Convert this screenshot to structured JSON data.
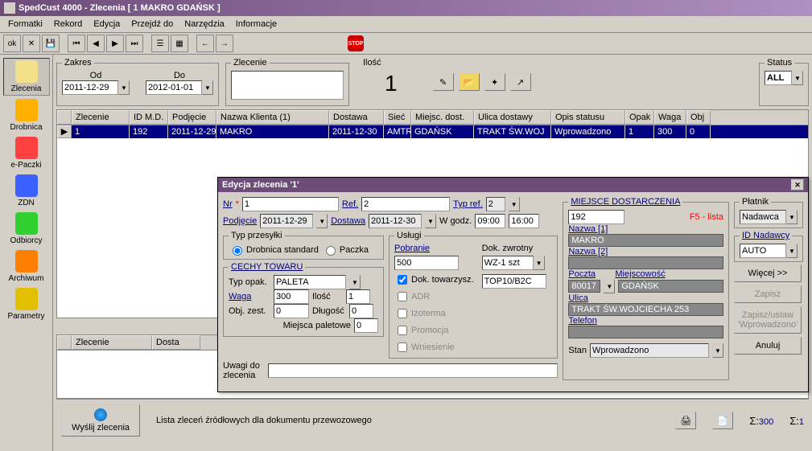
{
  "title": "SpedCust 4000 - Zlecenia [ 1 MAKRO GDAŃSK ]",
  "menu": [
    "Formatki",
    "Rekord",
    "Edycja",
    "Przejdź do",
    "Narzędzia",
    "Informacje"
  ],
  "toolbar": {
    "stop": "STOP"
  },
  "sidebar": [
    {
      "label": "Zlecenia",
      "icon": "#F5E08A"
    },
    {
      "label": "Drobnica",
      "icon": "#FFB000"
    },
    {
      "label": "e-Paczki",
      "icon": "#FF4040"
    },
    {
      "label": "ZDN",
      "icon": "#3A60FF"
    },
    {
      "label": "Odbiorcy",
      "icon": "#30D030"
    },
    {
      "label": "Archiwum",
      "icon": "#FF8000"
    },
    {
      "label": "Parametry",
      "icon": "#E0C000"
    }
  ],
  "panels": {
    "zakres": {
      "legend": "Zakres",
      "od_label": "Od",
      "do_label": "Do",
      "od": "2011-12-29",
      "do": "2012-01-01"
    },
    "zlecenie": {
      "legend": "Zlecenie",
      "value": ""
    },
    "ilosc": {
      "legend": "Ilość",
      "value": "1"
    },
    "status": {
      "legend": "Status",
      "value": "ALL"
    }
  },
  "grid": {
    "headers": [
      "Zlecenie",
      "ID M.D.",
      "Podjęcie",
      "Nazwa Klienta (1)",
      "Dostawa",
      "Sieć",
      "Miejsc. dost.",
      "Ulica dostawy",
      "Opis statusu",
      "Opak",
      "Waga",
      "Obj"
    ],
    "row": [
      "1",
      "192",
      "2011-12-29",
      "MAKRO",
      "2011-12-30",
      "AMTR",
      "GDAŃSK",
      "TRAKT ŚW.WOJ",
      "Wprowadzono",
      "1",
      "300",
      "0"
    ]
  },
  "lower_grid": {
    "headers": [
      "Zlecenie",
      "Dosta"
    ]
  },
  "footer": {
    "send_btn": "Wyślij zlecenia",
    "desc": "Lista zleceń źródłowych dla dokumentu przewozowego",
    "s1_val": "300",
    "s2_val": "1"
  },
  "dialog": {
    "title": "Edycja zlecenia '1'",
    "nr_label": "Nr",
    "nr": "1",
    "ref_label": "Ref.",
    "ref": "2",
    "typref_label": "Typ ref.",
    "typref": "2",
    "podjecie_label": "Podjęcie",
    "podjecie": "2011-12-29",
    "dostawa_label": "Dostawa",
    "dostawa": "2011-12-30",
    "wgodz_label": "W godz.",
    "godz1": "09:00",
    "godz2": "16:00",
    "typ_przesylki": {
      "legend": "Typ przesyłki",
      "opt1": "Drobnica standard",
      "opt2": "Paczka"
    },
    "cechy": {
      "legend": "CECHY TOWARU",
      "typopak_label": "Typ opak.",
      "typopak": "PALETA",
      "waga_label": "Waga",
      "waga": "300",
      "ilosc_label": "Ilość",
      "ilosc": "1",
      "objzest_label": "Obj. zest.",
      "objzest": "0",
      "dlugosc_label": "Długość",
      "dlugosc": "0",
      "miejsca_label": "Miejsca paletowe",
      "miejsca": "0"
    },
    "uslugi": {
      "legend": "Usługi",
      "pobranie_label": "Pobranie",
      "pobranie": "500",
      "dokzwrot_label": "Dok. zwrotny",
      "dokzwrot": "WZ-1 szt",
      "doktow": "Dok. towarzysz.",
      "doktow_val": "TOP10/B2C",
      "adr": "ADR",
      "izoterma": "Izoterma",
      "promocja": "Promocja",
      "wniesienie": "Wniesienie"
    },
    "uwagi_label": "Uwagi do zlecenia",
    "uwagi": "",
    "miejsce": {
      "legend": "MIEJSCE DOSTARCZENIA",
      "id": "192",
      "f5": "F5 - lista",
      "nazwa1_label": "Nazwa [1]",
      "nazwa1": "MAKRO",
      "nazwa2_label": "Nazwa [2]",
      "nazwa2": "",
      "poczta_label": "Poczta",
      "poczta": "80017",
      "miejscowosc_label": "Miejscowość",
      "miejscowosc": "GDAŃSK",
      "ulica_label": "Ulica",
      "ulica": "TRAKT ŚW.WOJCIECHA 253",
      "telefon_label": "Telefon",
      "telefon": "",
      "stan_label": "Stan",
      "stan": "Wprowadzono"
    },
    "platnik": {
      "legend": "Płatnik",
      "value": "Nadawca",
      "idnad_label": "ID Nadawcy",
      "idnad": "AUTO"
    },
    "btns": {
      "wiecej": "Więcej >>",
      "zapisz": "Zapisz",
      "zapisz_ustaw": "Zapisz/ustaw 'Wprowadzono'",
      "anuluj": "Anuluj"
    }
  }
}
